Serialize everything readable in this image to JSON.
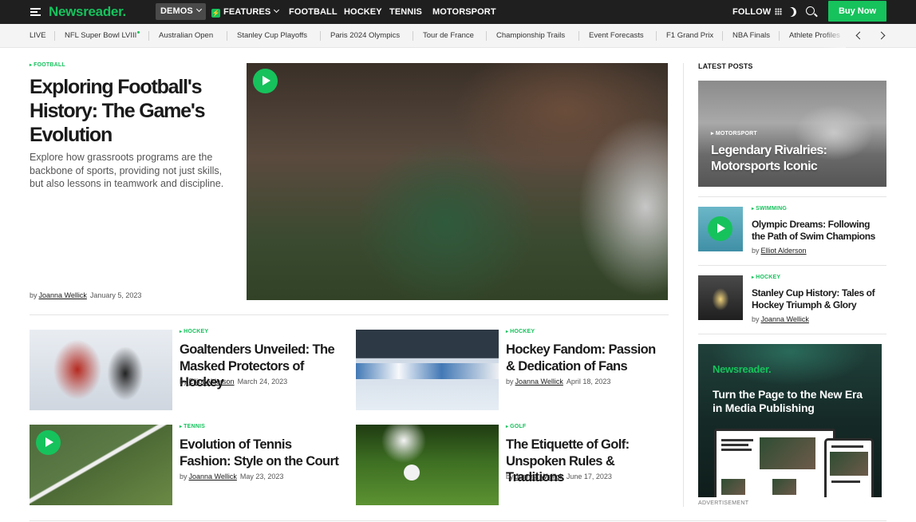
{
  "nav": {
    "logo": "Newsreader.",
    "demos": "DEMOS",
    "features": "FEATURES",
    "links": [
      "FOOTBALL",
      "HOCKEY",
      "TENNIS",
      "MOTORSPORT"
    ],
    "follow": "FOLLOW",
    "buy": "Buy Now",
    "accent": "#16c25c"
  },
  "trending": {
    "items": [
      "LIVE",
      "NFL Super Bowl LVIII",
      "Australian Open",
      "Stanley Cup Playoffs",
      "Paris 2024 Olympics",
      "Tour de France",
      "Championship Trails",
      "Event Forecasts",
      "F1 Grand Prix",
      "NBA Finals",
      "Athlete Profiles"
    ]
  },
  "hero": {
    "category": "FOOTBALL",
    "title": "Exploring Football's History: The Game's Evolution",
    "excerpt": "Explore how grassroots programs are the backbone of sports, providing not just skills, but also lessons in teamwork and discipline.",
    "by": "by",
    "author": "Joanna Wellick",
    "date": "January 5, 2023"
  },
  "grid": [
    {
      "category": "HOCKEY",
      "title": "Goaltenders Unveiled: The Masked Protectors of Hockey",
      "by": "by",
      "author": "Elliot Alderson",
      "date": "March 24, 2023"
    },
    {
      "category": "HOCKEY",
      "title": "Hockey Fandom: Passion & Dedication of Fans",
      "by": "by",
      "author": "Joanna Wellick",
      "date": "April 18, 2023"
    },
    {
      "category": "TENNIS",
      "title": "Evolution of Tennis Fashion: Style on the Court",
      "by": "by",
      "author": "Joanna Wellick",
      "date": "May 23, 2023"
    },
    {
      "category": "GOLF",
      "title": "The Etiquette of Golf: Unspoken Rules & Traditions",
      "by": "by",
      "author": "Joanna Wellick",
      "date": "June 17, 2023"
    }
  ],
  "sidebar": {
    "heading": "LATEST POSTS",
    "featured": {
      "category": "MOTORSPORT",
      "title": "Legendary Rivalries: Motorsports Iconic"
    },
    "posts": [
      {
        "category": "SWIMMING",
        "title": "Olympic Dreams: Following the Path of Swim Champions",
        "by": "by",
        "author": "Elliot Alderson"
      },
      {
        "category": "HOCKEY",
        "title": "Stanley Cup History: Tales of Hockey Triumph & Glory",
        "by": "by",
        "author": "Joanna Wellick"
      }
    ]
  },
  "ad": {
    "logo": "Newsreader.",
    "text": "Turn the Page to the New Era in Media Publishing",
    "label": "ADVERTISEMENT"
  }
}
